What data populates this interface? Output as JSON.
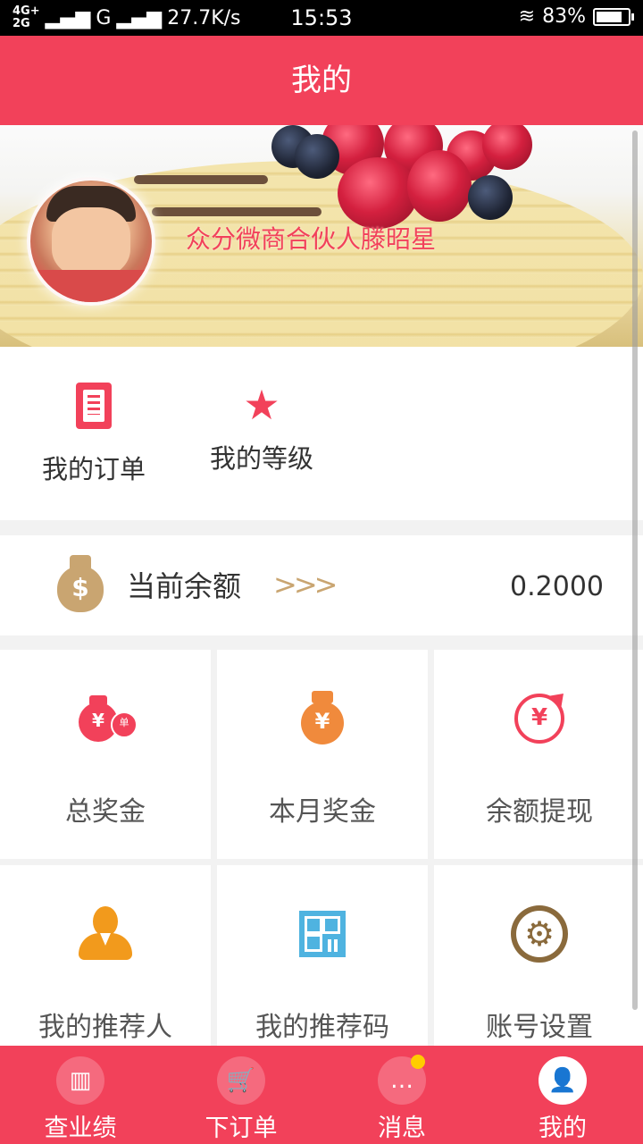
{
  "status_bar": {
    "network_top": "4G+",
    "network_bottom": "2G",
    "carrier": "G",
    "speed": "27.7K/s",
    "time": "15:53",
    "battery": "83%",
    "battery_level": 0.83
  },
  "header": {
    "title": "我的"
  },
  "banner": {
    "name": "众分微商合伙人滕昭星"
  },
  "quick_links": [
    {
      "label": "我的订单",
      "icon": "document-icon"
    },
    {
      "label": "我的等级",
      "icon": "star-icon"
    }
  ],
  "balance": {
    "label": "当前余额",
    "chevrons": "》》",
    "value": "0.2000",
    "icon": "money-bag-icon"
  },
  "grid": [
    {
      "label": "总奖金",
      "icon": "money-bags-icon",
      "sym": "¥"
    },
    {
      "label": "本月奖金",
      "icon": "money-bag-icon",
      "sym": "¥"
    },
    {
      "label": "余额提现",
      "icon": "withdraw-icon",
      "sym": "¥"
    },
    {
      "label": "我的推荐人",
      "icon": "referrer-icon"
    },
    {
      "label": "我的推荐码",
      "icon": "qr-code-icon"
    },
    {
      "label": "账号设置",
      "icon": "gear-icon",
      "sym": "⚙"
    }
  ],
  "bottom_nav": [
    {
      "label": "查业绩",
      "icon": "chart-icon",
      "glyph": "▥"
    },
    {
      "label": "下订单",
      "icon": "cart-icon",
      "glyph": "🛒"
    },
    {
      "label": "消息",
      "icon": "message-icon",
      "glyph": "…",
      "badge": true
    },
    {
      "label": "我的",
      "icon": "user-icon",
      "glyph": "👤",
      "active": true
    }
  ],
  "colors": {
    "accent": "#f2415a",
    "gold": "#c9a571",
    "orange": "#f08a3c",
    "blue": "#4fb3e0",
    "brown": "#8a6a3c"
  }
}
